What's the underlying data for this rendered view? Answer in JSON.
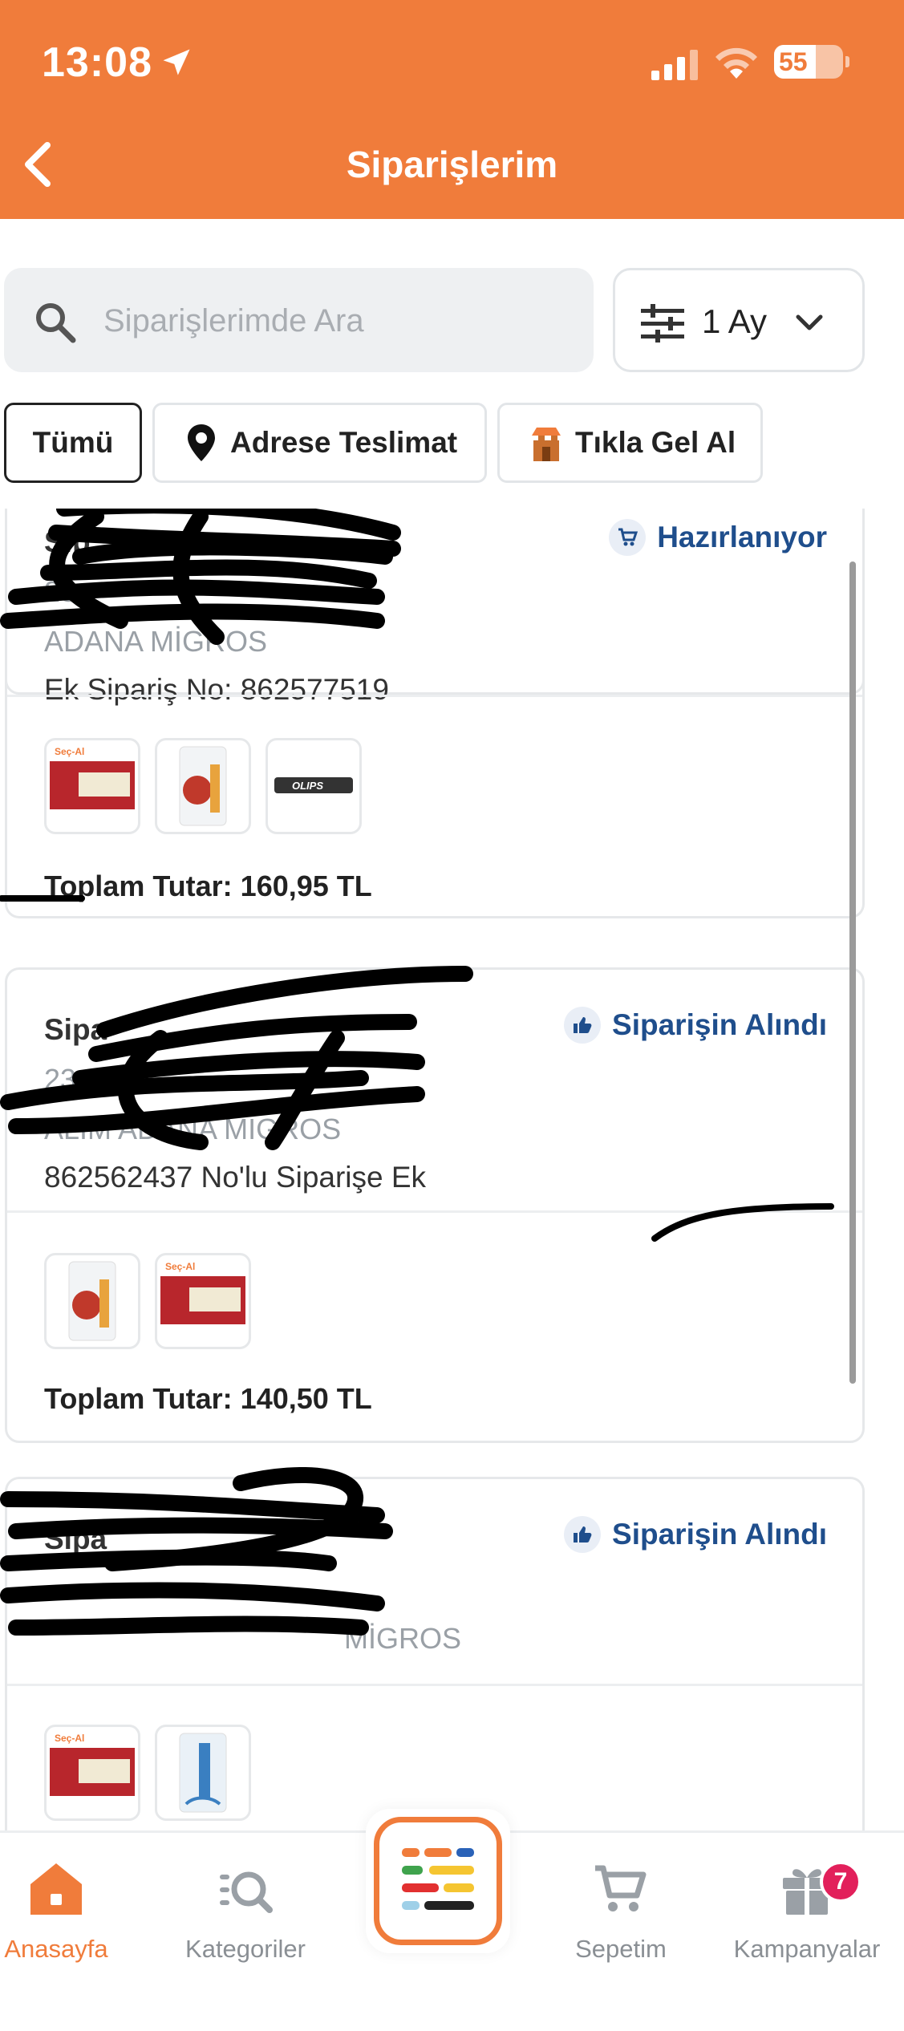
{
  "status_bar": {
    "time": "13:08",
    "battery": "55"
  },
  "header": {
    "title": "Siparişlerim"
  },
  "search": {
    "placeholder": "Siparişlerimde Ara"
  },
  "period_filter": {
    "label": "1 Ay"
  },
  "tabs": [
    {
      "label": "Tümü",
      "active": true
    },
    {
      "label": "Adrese Teslimat",
      "icon": "location-pin-icon"
    },
    {
      "label": "Tıkla Gel Al",
      "icon": "store-icon"
    }
  ],
  "orders": [
    {
      "title": "Sip",
      "date": "23.",
      "store": "ADANA MİGROS",
      "extra": "Ek Sipariş No: 862577519",
      "status": "Hazırlanıyor",
      "status_icon": "cart-icon",
      "total_label": "Toplam Tutar:",
      "total_value": "160,95 TL",
      "products": [
        "Seç-Al",
        "Migros poşet",
        "OLIPS"
      ]
    },
    {
      "title": "Sipa",
      "date": "23.",
      "store": "ALIM ADANA MİGROS",
      "extra": "862562437 No'lu Siparişe Ek",
      "status": "Siparişin Alındı",
      "status_icon": "thumbs-up-icon",
      "total_label": "Toplam Tutar:",
      "total_value": "140,50 TL",
      "products": [
        "Migros poşet",
        "Seç-Al"
      ]
    },
    {
      "title": "Sipa",
      "date": "",
      "store": "MİGROS",
      "extra": "",
      "status": "Siparişin Alındı",
      "status_icon": "thumbs-up-icon",
      "products": [
        "Seç-Al",
        "Migros poşet"
      ]
    }
  ],
  "bottom_nav": {
    "home": "Anasayfa",
    "categories": "Kategoriler",
    "cart": "Sepetim",
    "campaigns": "Kampanyalar",
    "campaigns_badge": "7"
  },
  "colors": {
    "brand": "#f07c3b",
    "status_blue": "#1f4e8c",
    "badge": "#e2205b"
  }
}
